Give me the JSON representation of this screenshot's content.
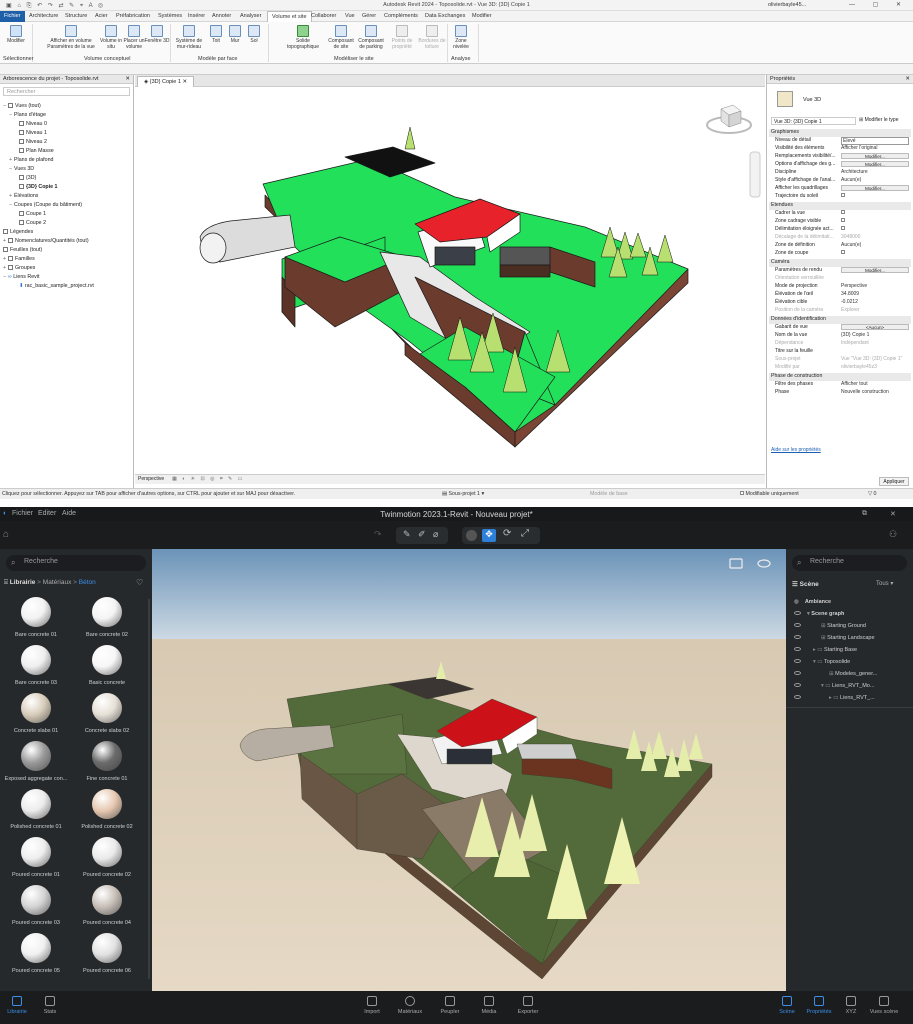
{
  "revit": {
    "window_title": "Autodesk Revit 2024 - Toposolide.rvt - Vue 3D: {3D} Copie 1",
    "user": "olivierbayle45...",
    "tabs": [
      "Fichier",
      "Architecture",
      "Structure",
      "Acier",
      "Préfabrication",
      "Systèmes",
      "Insérer",
      "Annoter",
      "Analyser",
      "Volume et site",
      "Collaborer",
      "Vue",
      "Gérer",
      "Compléments",
      "Data Exchanges",
      "Modifier"
    ],
    "ribbon": {
      "buttons": [
        "Modifier",
        "Afficher en volume Paramètres de la vue",
        "Volume in situ",
        "Placer un volume",
        "Fenêtre 3D",
        "Système de mur-rideau",
        "Toit",
        "Mur",
        "Sol",
        "Solide topographique",
        "Composant de site",
        "Composant de parking",
        "Points de propriété",
        "Bordures de toiture",
        "Zone nivelée"
      ],
      "panels": [
        "Sélectionner",
        "Volume conceptuel",
        "Modèle par face",
        "Modéliser le site",
        "Analyse"
      ]
    },
    "browser": {
      "title": "Arborescence du projet - Toposolide.rvt",
      "search_placeholder": "Rechercher",
      "items": [
        "Vues (tout)",
        "Plans d'étage",
        "Niveau 0",
        "Niveau 1",
        "Niveau 2",
        "Plan Masse",
        "Plans de plafond",
        "Vues 3D",
        "{3D}",
        "{3D} Copie 1",
        "Élévations",
        "Coupes (Coupe du bâtiment)",
        "Coupe 1",
        "Coupe 2",
        "Légendes",
        "Nomenclatures/Quantités (tout)",
        "Feuilles (tout)",
        "Familles",
        "Groupes",
        "Liens Revit",
        "rac_basic_sample_project.rvt"
      ]
    },
    "view_tab": "{3D} Copie 1",
    "view_bar": "Perspective",
    "props": {
      "title": "Propriétés",
      "type_name": "Vue 3D",
      "selector": "Vue 3D: {3D} Copie 1",
      "edit_type": "Modifier le type",
      "groups": {
        "graphismes": "Graphismes",
        "etendues": "Etendues",
        "camera": "Caméra",
        "identification": "Données d'identification",
        "phase": "Phase de construction"
      },
      "rows": {
        "niveau_detail": [
          "Niveau de détail",
          "Elevé"
        ],
        "visibilite": [
          "Visibilité des éléments",
          "Afficher l'original"
        ],
        "remplacements": [
          "Remplacements visibilité/...",
          "Modifier..."
        ],
        "options_affichage": [
          "Options d'affichage des g...",
          "Modifier..."
        ],
        "discipline": [
          "Discipline",
          "Architecture"
        ],
        "style_analyse": [
          "Style d'affichage de l'anal...",
          "Aucun(e)"
        ],
        "quadrillages": [
          "Afficher les quadrillages",
          "Modifier..."
        ],
        "trajectoire": [
          "Trajectoire du soleil",
          ""
        ],
        "cadrer": [
          "Cadrer la vue",
          ""
        ],
        "zone_cadrage": [
          "Zone cadrage visible",
          ""
        ],
        "delimitation": [
          "Délimitation éloignée act...",
          ""
        ],
        "decalage": [
          "Décalage de la délimitati...",
          "3048000"
        ],
        "zone_definition": [
          "Zone de définition",
          "Aucun(e)"
        ],
        "zone_coupe": [
          "Zone de coupe",
          ""
        ],
        "params_rendu": [
          "Paramètres de rendu",
          "Modifier..."
        ],
        "orientation": [
          "Orientation verrouillée",
          ""
        ],
        "mode_projection": [
          "Mode de projection",
          "Perspective"
        ],
        "elevation_oeil": [
          "Élévation de l'œil",
          "34.8009"
        ],
        "elevation_cible": [
          "Élévation cible",
          "-0.0212"
        ],
        "position_camera": [
          "Position de la caméra",
          "Explorer"
        ],
        "gabarit": [
          "Gabarit de vue",
          "<Aucun>"
        ],
        "nom_vue": [
          "Nom de la vue",
          "{3D} Copie 1"
        ],
        "dependance": [
          "Dépendance",
          "Indépendant"
        ],
        "titre_feuille": [
          "Titre sur la feuille",
          ""
        ],
        "sous_projet": [
          "Sous-projet",
          "Vue \"Vue 3D: {3D} Copie 1\""
        ],
        "modifie_par": [
          "Modifié par",
          "olivierbayle45z3"
        ],
        "filtre_phases": [
          "Filtre des phases",
          "Afficher tout"
        ],
        "phase": [
          "Phase",
          "Nouvelle construction"
        ]
      },
      "help_link": "Aide sur les propriétés",
      "apply": "Appliquer"
    },
    "status": {
      "hint": "Cliquez pour sélectionner. Appuyez sur TAB pour afficher d'autres options, sur CTRL pour ajouter et sur MAJ pour désactiver.",
      "workset": "Sous-projet 1",
      "model": "Modèle de base",
      "editable": "Modifiable uniquement",
      "filter": "0"
    }
  },
  "twinmotion": {
    "menu": [
      "Fichier",
      "Editer",
      "Aide"
    ],
    "title": "Twinmotion 2023.1-Revit - Nouveau projet*",
    "search_placeholder": "Recherche",
    "breadcrumb": [
      "Librairie",
      "Matériaux",
      "Béton"
    ],
    "materials": [
      "Bare concrete 01",
      "Bare concrete 02",
      "Bare concrete 03",
      "Basic concrete",
      "Concrete slabs 01",
      "Concrete slabs 02",
      "Exposed aggregate con...",
      "Fine concrete 01",
      "Polished concrete 01",
      "Polished concrete 02",
      "Poured concrete 01",
      "Poured concrete 02",
      "Poured concrete 03",
      "Poured concrete 04",
      "Poured concrete 05",
      "Poured concrete 06"
    ],
    "material_colors": [
      "#f2f2f2",
      "#f4f4f4",
      "#efefef",
      "#f6f6f6",
      "#d8cdbb",
      "#e6e0d6",
      "#9a9a9a",
      "#6b6b6b",
      "#ececec",
      "#e7c9b2",
      "#eeeeee",
      "#eaeaea",
      "#d4d4d4",
      "#c8c0b8",
      "#f0f0f0",
      "#e2e2e2"
    ],
    "scene": {
      "title": "Scène",
      "filter": "Tous",
      "items": [
        "Ambiance",
        "Scene graph",
        "Starting Ground",
        "Starting Landscape",
        "Starting Base",
        "Toposolide",
        "Modeles_gener...",
        "Liens_RVT_Mo...",
        "Liens_RVT_..."
      ]
    },
    "bottom": [
      "Librairie",
      "Stats",
      "Import",
      "Matériaux",
      "Peupler",
      "Média",
      "Exporter",
      "Scène",
      "Propriétés",
      "XYZ",
      "Vues scène"
    ]
  }
}
